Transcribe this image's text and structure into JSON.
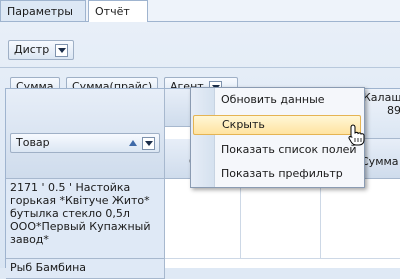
{
  "tabs": [
    {
      "label": "Параметры",
      "active": false
    },
    {
      "label": "Отчёт",
      "active": true
    }
  ],
  "filter_field": {
    "label": "Дистр"
  },
  "data_fields": [
    "Сумма",
    "Сумма(прайс)",
    "Агент"
  ],
  "row_field": {
    "label": "Товар"
  },
  "column_headers": {
    "partial_top": "Калаш",
    "partial_num": "89",
    "partial_left": "С",
    "partial_right": "Сумма"
  },
  "row": {
    "label": "2171 ' 0.5 ' Настойка горькая *Квітуче Жито* бутылка стекло 0,5л ООО*Первый Купажный завод*",
    "next_partial": "Рыб Бамбина"
  },
  "context_menu": {
    "items": [
      {
        "label": "Обновить данные",
        "highlighted": false
      },
      {
        "label": "Скрыть",
        "highlighted": true
      },
      {
        "label": "Показать список полей",
        "highlighted": false
      },
      {
        "label": "Показать префильтр",
        "highlighted": false
      }
    ]
  },
  "colors": {
    "highlight": "#ffe3a1",
    "panel": "#dfe9f5",
    "header": "#cfdcec"
  }
}
